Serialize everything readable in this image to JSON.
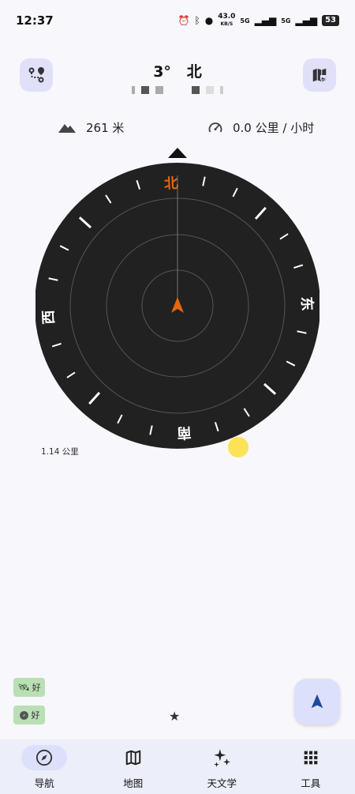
{
  "status_bar": {
    "time": "12:37",
    "net_speed": "43.0",
    "net_unit": "KB/S",
    "sig1": "5G",
    "sig2": "5G",
    "battery": "53"
  },
  "header": {
    "heading_value": "3°",
    "heading_dir": "北"
  },
  "info": {
    "altitude": "261 米",
    "speed": "0.0 公里 / 小时"
  },
  "compass": {
    "north": "北",
    "east": "东",
    "south": "南",
    "west": "西",
    "heading_deg": 3,
    "accent": "#e8650a"
  },
  "distance_label": "1.14 公里",
  "chips": {
    "satellite_status": "好",
    "compass_status": "好"
  },
  "nav": {
    "items": [
      {
        "label": "导航"
      },
      {
        "label": "地图"
      },
      {
        "label": "天文学"
      },
      {
        "label": "工具"
      }
    ]
  },
  "icons": {
    "route": "route-icon",
    "map": "map-icon",
    "altitude": "mountain-icon",
    "speed": "speedometer-icon",
    "fab": "navigation-arrow-icon"
  }
}
